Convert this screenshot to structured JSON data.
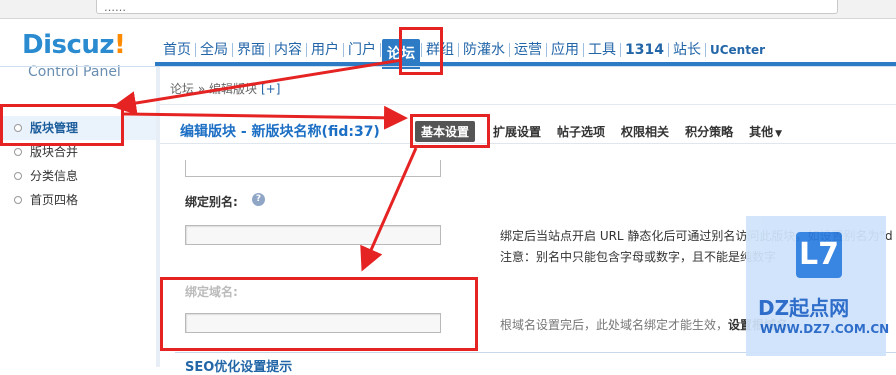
{
  "browser": {
    "address_text": "……"
  },
  "logo": {
    "brand_a": "Discuz",
    "brand_b": "!",
    "subtitle": "Control Panel"
  },
  "nav": {
    "items": [
      {
        "label": "首页"
      },
      {
        "label": "全局"
      },
      {
        "label": "界面"
      },
      {
        "label": "内容"
      },
      {
        "label": "用户"
      },
      {
        "label": "门户"
      },
      {
        "label": "论坛",
        "active": true
      },
      {
        "label": "群组"
      },
      {
        "label": "防灌水"
      },
      {
        "label": "运营"
      },
      {
        "label": "应用"
      },
      {
        "label": "工具"
      },
      {
        "label": "1314"
      },
      {
        "label": "站长"
      },
      {
        "label": "UCenter"
      }
    ]
  },
  "sidebar": {
    "items": [
      {
        "label": "版块管理",
        "active": true
      },
      {
        "label": "版块合并"
      },
      {
        "label": "分类信息"
      },
      {
        "label": "首页四格"
      }
    ]
  },
  "breadcrumb": {
    "text": "论坛 » 编辑版块",
    "plus": "[+]"
  },
  "page": {
    "title": "编辑版块 - 新版块名称(fid:37)",
    "tabs": [
      {
        "label": "基本设置",
        "active": true
      },
      {
        "label": "扩展设置"
      },
      {
        "label": "帖子选项"
      },
      {
        "label": "权限相关"
      },
      {
        "label": "积分策略"
      },
      {
        "label": "其他"
      }
    ],
    "caret": "▼"
  },
  "form": {
    "alias_label": "绑定别名:",
    "alias_help": "?",
    "alias_desc_1": "绑定后当站点开启 URL 静态化后可通过别名访问此版块，如设置别名为\"d",
    "alias_desc_2": "注意：别名中只能包含字母或数字，且不能是纯数字",
    "domain_label": "绑定域名:",
    "domain_desc": "根域名设置完后，此处域名绑定才能生效，",
    "domain_desc_link": "设置根域名",
    "seo_title": "SEO优化设置提示"
  },
  "watermark": {
    "logo": "L7",
    "title": "DZ起点网",
    "url": "WWW.DZ7.COM.CN"
  },
  "colors": {
    "accent": "#2d7bc4",
    "annotation": "#e52322",
    "title": "#1c6fc4"
  }
}
